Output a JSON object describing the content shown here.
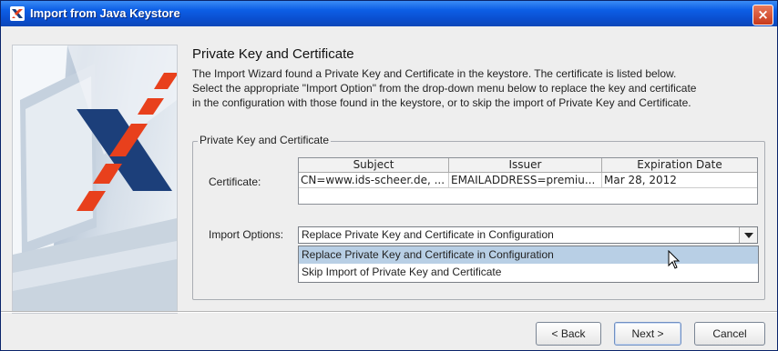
{
  "window": {
    "title": "Import from Java Keystore",
    "close_glyph": "×"
  },
  "main": {
    "heading": "Private Key and Certificate",
    "description_lines": [
      "The Import Wizard found a Private Key and Certificate in the keystore. The certificate is listed below.",
      "Select the appropriate \"Import Option\" from the drop-down menu below to replace the key and certificate",
      "in the configuration with those found in the keystore, or to skip the import of Private Key and Certificate."
    ]
  },
  "group": {
    "title": "Private Key and Certificate",
    "certificate_label": "Certificate:",
    "table": {
      "columns": [
        "Subject",
        "Issuer",
        "Expiration Date"
      ],
      "rows": [
        [
          "CN=www.ids-scheer.de, ...",
          "EMAILADDRESS=premiu...",
          "Mar 28, 2012"
        ]
      ]
    },
    "import_options_label": "Import Options:",
    "import_options": {
      "selected": "Replace Private Key and Certificate in Configuration",
      "options": [
        "Replace Private Key and Certificate in Configuration",
        "Skip Import of Private Key and Certificate"
      ],
      "highlighted_index": 0
    }
  },
  "buttons": {
    "back": "< Back",
    "next": "Next >",
    "cancel": "Cancel"
  },
  "colors": {
    "titlebar": "#0a4fd0",
    "logo_red": "#e8401c",
    "logo_navy": "#1c3f7a",
    "dropdown_highlight": "#b8cfe5"
  }
}
